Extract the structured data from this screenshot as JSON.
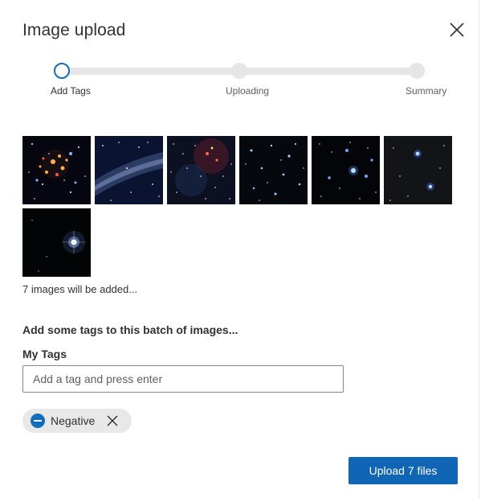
{
  "dialog": {
    "title": "Image upload",
    "close_icon": "close-icon"
  },
  "stepper": {
    "steps": [
      {
        "label": "Add Tags",
        "state": "active"
      },
      {
        "label": "Uploading",
        "state": "pending"
      },
      {
        "label": "Summary",
        "state": "pending"
      }
    ],
    "accent_color": "#106ebe"
  },
  "images": {
    "items": [
      {
        "name": "star-cluster-image"
      },
      {
        "name": "milky-way-image"
      },
      {
        "name": "nebula-starfield-image"
      },
      {
        "name": "blue-stars-image"
      },
      {
        "name": "constellation-image"
      },
      {
        "name": "sparse-stars-image"
      },
      {
        "name": "bright-star-image"
      }
    ],
    "count_text": "7 images will be added..."
  },
  "tags": {
    "heading": "Add some tags to this batch of images...",
    "field_label": "My Tags",
    "input_value": "",
    "input_placeholder": "Add a tag and press enter",
    "chips": [
      {
        "label": "Negative",
        "icon": "minus-circle-icon",
        "remove_icon": "close-icon"
      }
    ]
  },
  "footer": {
    "upload_label": "Upload 7 files",
    "button_color": "#1065b4"
  }
}
